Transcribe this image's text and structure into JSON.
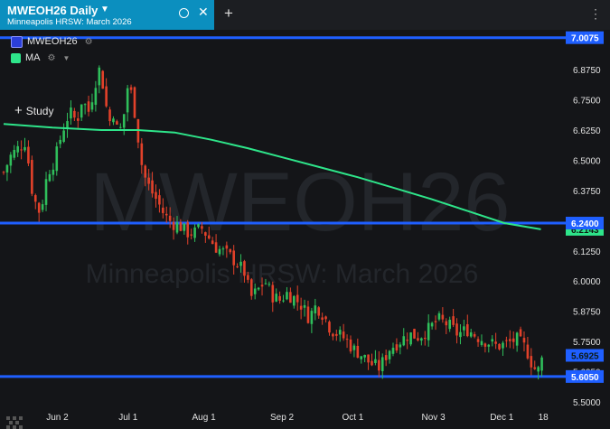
{
  "tab": {
    "title": "MWEOH26 Daily",
    "subtitle": "Minneapolis HRSW: March 2026"
  },
  "legend": {
    "symbol": "MWEOH26",
    "symbol_color": "#2b3fd8",
    "ma": "MA",
    "ma_color": "#2ee58a",
    "study": "Study"
  },
  "icons": {
    "dropdown": "chevron-down-icon",
    "circle": "circle-icon",
    "close": "close-icon",
    "add": "plus-icon",
    "more": "more-vertical-icon",
    "gear": "gear-icon"
  },
  "watermark": {
    "symbol": "MWEOH26",
    "name": "Minneapolis HRSW: March 2026"
  },
  "colors": {
    "up": "#2fbf5b",
    "down": "#e2412a",
    "ma": "#2ee58a",
    "hline": "#1f5fff",
    "background": "#141518"
  },
  "chart_data": {
    "type": "candlestick",
    "y_ticks": [
      "6.8750",
      "6.7500",
      "6.6250",
      "6.5000",
      "6.3750",
      "6.2500",
      "6.1250",
      "6.0000",
      "5.8750",
      "5.7500",
      "5.6250",
      "5.5000"
    ],
    "ylim": [
      5.47,
      7.04
    ],
    "x_ticks": [
      {
        "label": "Jun 2",
        "day": 22
      },
      {
        "label": "Jul 1",
        "day": 51
      },
      {
        "label": "Aug 1",
        "day": 82
      },
      {
        "label": "Sep 2",
        "day": 114
      },
      {
        "label": "Oct 1",
        "day": 143
      },
      {
        "label": "Nov 3",
        "day": 176
      },
      {
        "label": "Dec 1",
        "day": 204
      },
      {
        "label": "18",
        "day": 221
      }
    ],
    "xlim": [
      0,
      225
    ],
    "horizontal_lines": [
      {
        "label": "7.0075",
        "value": 7.0075
      },
      {
        "label": "6.2400",
        "value": 6.24
      },
      {
        "label": "5.6050",
        "value": 5.605
      }
    ],
    "price_markers": [
      {
        "label": "6.2143",
        "value": 6.2143,
        "color": "#2ee58a"
      },
      {
        "label": "5.6925",
        "value": 5.6925,
        "color": "#1f5fff"
      }
    ],
    "ma_series": [
      [
        0,
        6.65
      ],
      [
        20,
        6.635
      ],
      [
        40,
        6.625
      ],
      [
        55,
        6.625
      ],
      [
        70,
        6.615
      ],
      [
        85,
        6.585
      ],
      [
        100,
        6.55
      ],
      [
        115,
        6.51
      ],
      [
        130,
        6.47
      ],
      [
        145,
        6.43
      ],
      [
        160,
        6.385
      ],
      [
        175,
        6.34
      ],
      [
        190,
        6.29
      ],
      [
        205,
        6.24
      ],
      [
        220,
        6.2143
      ]
    ],
    "close_series": [
      [
        0,
        6.45
      ],
      [
        3,
        6.52
      ],
      [
        6,
        6.55
      ],
      [
        9,
        6.58
      ],
      [
        12,
        6.35
      ],
      [
        15,
        6.28
      ],
      [
        18,
        6.45
      ],
      [
        21,
        6.5
      ],
      [
        24,
        6.62
      ],
      [
        27,
        6.7
      ],
      [
        30,
        6.66
      ],
      [
        32,
        6.75
      ],
      [
        35,
        6.7
      ],
      [
        37,
        6.8
      ],
      [
        39,
        6.88
      ],
      [
        41,
        6.8
      ],
      [
        43,
        6.65
      ],
      [
        45,
        6.7
      ],
      [
        47,
        6.6
      ],
      [
        49,
        6.67
      ],
      [
        51,
        6.82
      ],
      [
        53,
        6.75
      ],
      [
        55,
        6.6
      ],
      [
        57,
        6.45
      ],
      [
        60,
        6.38
      ],
      [
        63,
        6.33
      ],
      [
        66,
        6.27
      ],
      [
        69,
        6.24
      ],
      [
        72,
        6.23
      ],
      [
        75,
        6.2
      ],
      [
        78,
        6.2
      ],
      [
        81,
        6.22
      ],
      [
        84,
        6.18
      ],
      [
        87,
        6.14
      ],
      [
        90,
        6.12
      ],
      [
        93,
        6.1
      ],
      [
        96,
        6.07
      ],
      [
        99,
        6.03
      ],
      [
        101,
        5.93
      ],
      [
        104,
        5.96
      ],
      [
        107,
        6.0
      ],
      [
        110,
        5.94
      ],
      [
        113,
        5.92
      ],
      [
        116,
        5.95
      ],
      [
        119,
        5.93
      ],
      [
        122,
        5.9
      ],
      [
        125,
        5.85
      ],
      [
        128,
        5.9
      ],
      [
        131,
        5.86
      ],
      [
        134,
        5.8
      ],
      [
        137,
        5.78
      ],
      [
        140,
        5.76
      ],
      [
        143,
        5.72
      ],
      [
        146,
        5.7
      ],
      [
        150,
        5.66
      ],
      [
        154,
        5.64
      ],
      [
        158,
        5.72
      ],
      [
        162,
        5.75
      ],
      [
        166,
        5.78
      ],
      [
        170,
        5.77
      ],
      [
        174,
        5.8
      ],
      [
        178,
        5.84
      ],
      [
        182,
        5.82
      ],
      [
        186,
        5.78
      ],
      [
        190,
        5.8
      ],
      [
        194,
        5.77
      ],
      [
        198,
        5.75
      ],
      [
        202,
        5.73
      ],
      [
        206,
        5.74
      ],
      [
        210,
        5.76
      ],
      [
        214,
        5.72
      ],
      [
        217,
        5.64
      ],
      [
        219,
        5.63
      ],
      [
        221,
        5.6925
      ]
    ]
  }
}
